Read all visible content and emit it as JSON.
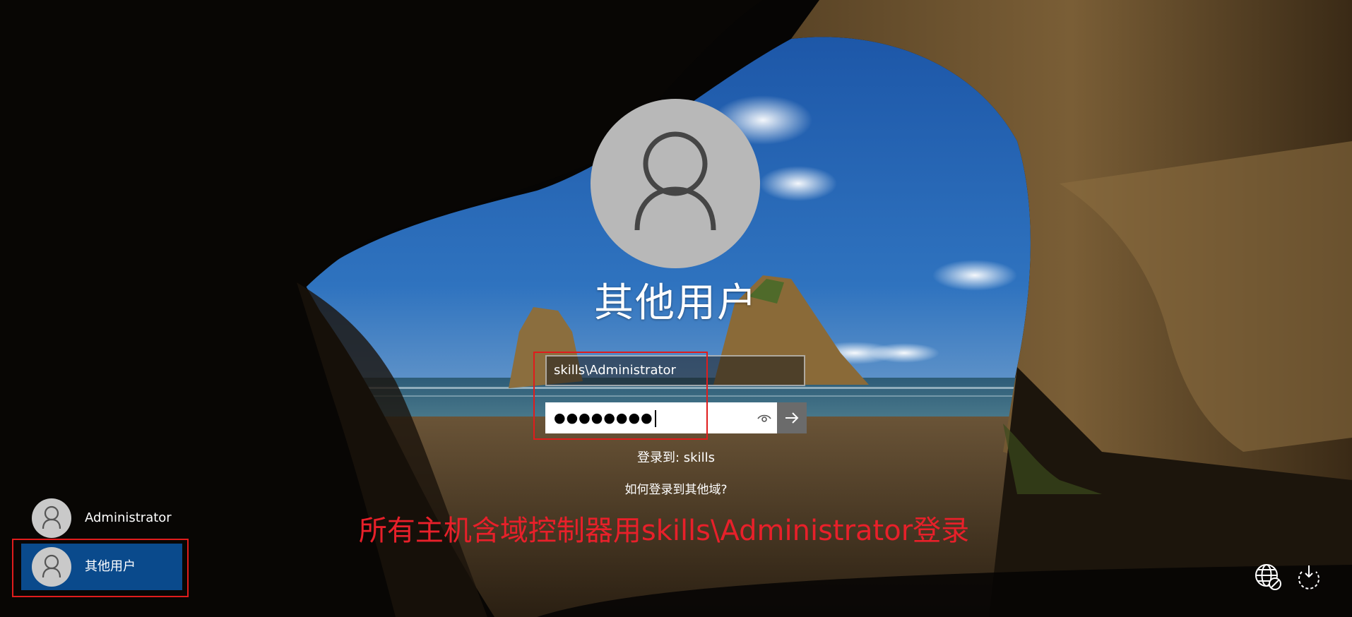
{
  "login": {
    "title": "其他用户",
    "username_value": "skills\\Administrator",
    "password_mask": "●●●●●●●●",
    "signin_to": "登录到: skills",
    "other_domain_link": "如何登录到其他域?"
  },
  "annotation": {
    "text": "所有主机含域控制器用skills\\Administrator登录",
    "color": "#e8202a"
  },
  "user_list": [
    {
      "name": "Administrator",
      "selected": false
    },
    {
      "name": "其他用户",
      "selected": true
    }
  ],
  "icons": {
    "avatar": "person-icon",
    "reveal": "eye-icon",
    "submit": "arrow-right-icon",
    "network": "network-globe-icon",
    "power": "power-icon"
  },
  "colors": {
    "selected_user_bg": "#0a4a8c",
    "annotation_box": "#e01c1c"
  }
}
